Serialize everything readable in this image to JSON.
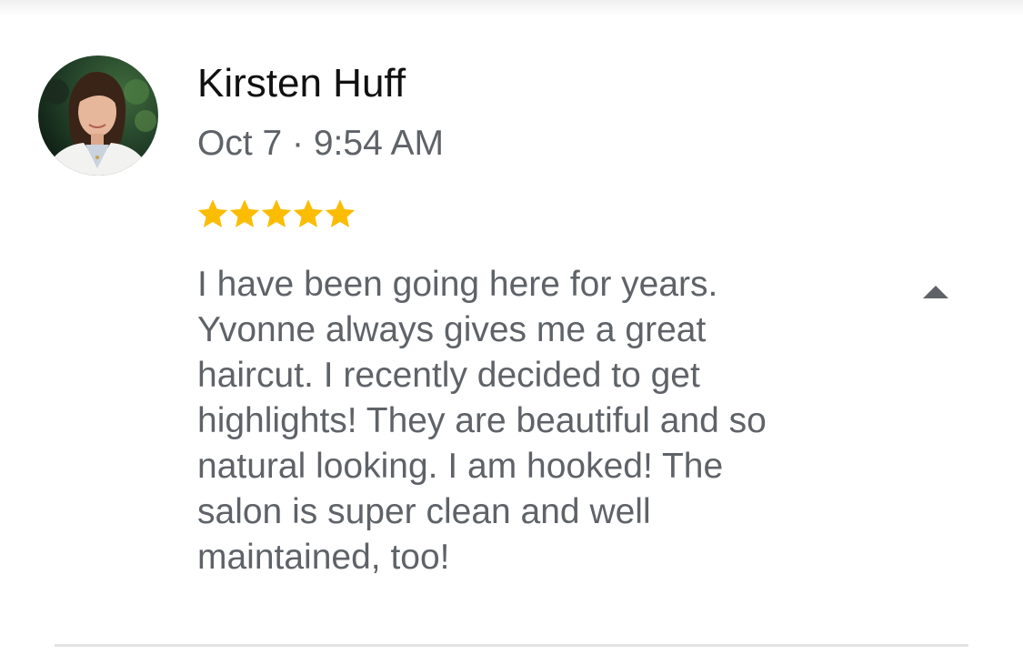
{
  "review": {
    "reviewer_name": "Kirsten Huff",
    "date": "Oct 7 · 9:54 AM",
    "rating": 5,
    "rating_max": 5,
    "star_color": "#fbbc04",
    "text_lines": [
      "I have been going here for years.",
      "Yvonne always gives me a great",
      "haircut. I recently decided to get",
      "highlights! They are beautiful and so",
      "natural looking. I am hooked! The",
      "salon is super clean and well",
      "maintained, too!"
    ],
    "collapse_icon": "triangle-up-icon"
  }
}
